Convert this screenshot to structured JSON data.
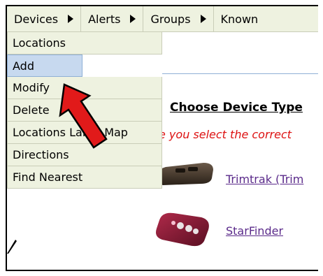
{
  "menubar": {
    "items": [
      {
        "label": "Devices"
      },
      {
        "label": "Alerts"
      },
      {
        "label": "Groups"
      },
      {
        "label": "Known"
      }
    ]
  },
  "dropdown": {
    "items": [
      {
        "label": "Locations"
      },
      {
        "label": "Add"
      },
      {
        "label": "Modify"
      },
      {
        "label": "Delete"
      },
      {
        "label": "Locations Large Map"
      },
      {
        "label": "Directions"
      },
      {
        "label": "Find Nearest"
      }
    ]
  },
  "content": {
    "heading": "Choose Device Type",
    "note": "e you select the correct",
    "devices": [
      {
        "label": "Trimtrak (Trim"
      },
      {
        "label": "StarFinder"
      }
    ]
  },
  "annotation": {
    "arrow_color": "#e11a1a",
    "highlight_item": "Add"
  }
}
